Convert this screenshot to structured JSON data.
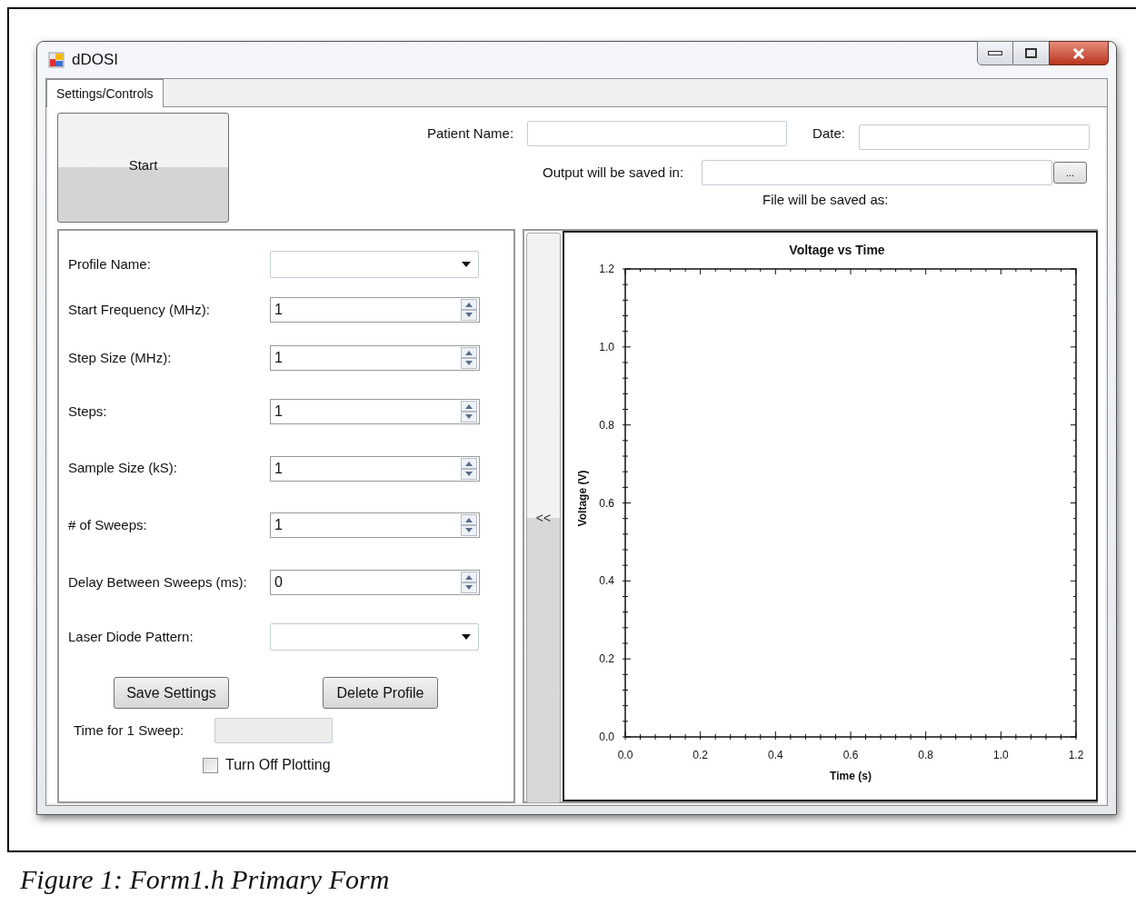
{
  "window": {
    "title": "dDOSI"
  },
  "tabs": [
    {
      "label": "Settings/Controls",
      "selected": true
    }
  ],
  "start_button": "Start",
  "patient_name": {
    "label": "Patient Name:"
  },
  "date": {
    "label": "Date:"
  },
  "output": {
    "label": "Output will be saved in:",
    "browse_button": "..."
  },
  "file_saved_as": "File will be saved as:",
  "settings": [
    {
      "kind": "dropdown",
      "label": "Profile Name:"
    },
    {
      "kind": "spinner",
      "label": "Start Frequency (MHz):",
      "value": "1"
    },
    {
      "kind": "spinner",
      "label": "Step Size (MHz):",
      "value": "1"
    },
    {
      "kind": "spinner",
      "label": "Steps:",
      "value": "1"
    },
    {
      "kind": "spinner",
      "label": "Sample Size (kS):",
      "value": "1"
    },
    {
      "kind": "spinner",
      "label": "# of Sweeps:",
      "value": "1"
    },
    {
      "kind": "spinner",
      "label": "Delay Between Sweeps (ms):",
      "value": "0"
    },
    {
      "kind": "dropdown",
      "label": "Laser Diode Pattern:"
    }
  ],
  "buttons": [
    "Save Settings",
    "Delete Profile"
  ],
  "time_for_sweep": {
    "label": "Time for 1 Sweep:",
    "disabled": true
  },
  "turn_off_plotting": {
    "label": "Turn Off Plotting",
    "checked": false
  },
  "collapse_button": "<<",
  "chart": {
    "chart_data": {
      "type": "line",
      "title": "Voltage vs Time",
      "xlabel": "Time (s)",
      "ylabel": "Voltage (V)",
      "xlim": [
        0,
        1.2
      ],
      "ylim": [
        0,
        1.2
      ],
      "xticks": [
        {
          "value": 0,
          "label": "0.0"
        },
        {
          "value": 0.2,
          "label": "0.2"
        },
        {
          "value": 0.4,
          "label": "0.4"
        },
        {
          "value": 0.6,
          "label": "0.6"
        },
        {
          "value": 0.8,
          "label": "0.8"
        },
        {
          "value": 1,
          "label": "1.0"
        },
        {
          "value": 1.2,
          "label": "1.2"
        }
      ],
      "yticks": [
        {
          "value": 0,
          "label": "0.0"
        },
        {
          "value": 0.2,
          "label": "0.2"
        },
        {
          "value": 0.4,
          "label": "0.4"
        },
        {
          "value": 0.6,
          "label": "0.6"
        },
        {
          "value": 0.8,
          "label": "0.8"
        },
        {
          "value": 1,
          "label": "1.0"
        },
        {
          "value": 1.2,
          "label": "1.2"
        }
      ]
    }
  },
  "caption": "Figure 1: Form1.h Primary Form"
}
